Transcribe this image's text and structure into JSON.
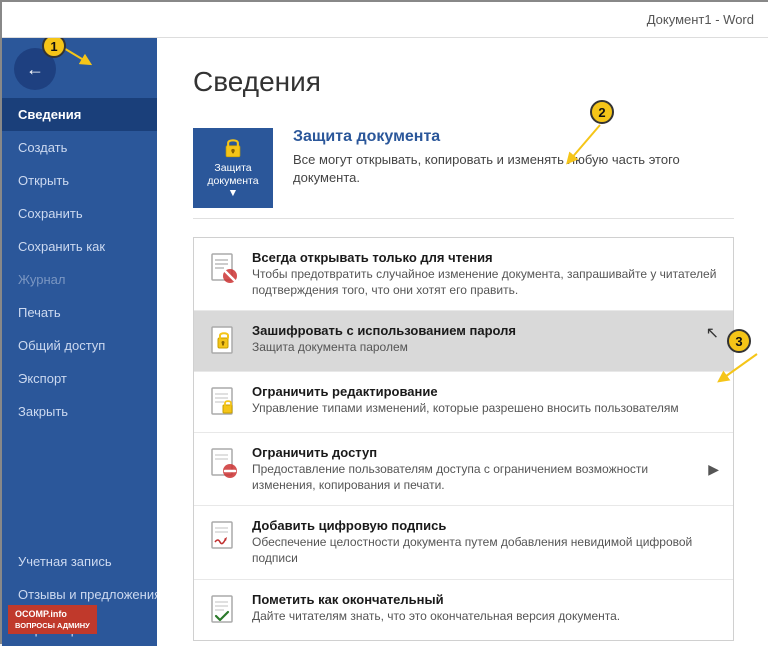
{
  "titlebar": {
    "text": "Документ1 - Word"
  },
  "sidebar": {
    "back_label": "←",
    "items": [
      {
        "id": "svedenia",
        "label": "Сведения",
        "active": true
      },
      {
        "id": "sozdat",
        "label": "Создать",
        "active": false
      },
      {
        "id": "otkryt",
        "label": "Открыть",
        "active": false
      },
      {
        "id": "sohranit",
        "label": "Сохранить",
        "active": false
      },
      {
        "id": "sohranit-kak",
        "label": "Сохранить как",
        "active": false
      },
      {
        "id": "zhurnal",
        "label": "Журнал",
        "disabled": true
      },
      {
        "id": "pechat",
        "label": "Печать",
        "active": false
      },
      {
        "id": "obshiy-dostup",
        "label": "Общий доступ",
        "active": false
      },
      {
        "id": "eksport",
        "label": "Экспорт",
        "active": false
      },
      {
        "id": "zakryt",
        "label": "Закрыть",
        "active": false
      }
    ],
    "bottom_items": [
      {
        "id": "uchet-zapis",
        "label": "Учетная запись"
      },
      {
        "id": "otzyvy",
        "label": "Отзывы и предложения"
      },
      {
        "id": "parametry",
        "label": "Параметры"
      }
    ]
  },
  "main": {
    "title": "Сведения",
    "protect": {
      "icon_label": "Защита документа▼",
      "title": "Защита документа",
      "description": "Все могут открывать, копировать и изменять любую часть этого документа."
    },
    "menu_items": [
      {
        "id": "read-only",
        "title": "Всегда открывать только для чтения",
        "description": "Чтобы предотвратить случайное изменение документа, запрашивайте у читателей подтверждения того, что они хотят его править.",
        "icon": "🚫",
        "selected": false,
        "has_arrow": false
      },
      {
        "id": "encrypt",
        "title": "Зашифровать с использованием пароля",
        "description": "Защита документа паролем",
        "icon": "🔐",
        "selected": true,
        "has_arrow": false
      },
      {
        "id": "restrict-edit",
        "title": "Ограничить редактирование",
        "description": "Управление типами изменений, которые разрешено вносить пользователям",
        "icon": "📄",
        "selected": false,
        "has_arrow": false
      },
      {
        "id": "restrict-access",
        "title": "Ограничить доступ",
        "description": "Предоставление пользователям доступа с ограничением возможности изменения, копирования и печати.",
        "icon": "🚫",
        "selected": false,
        "has_arrow": true
      },
      {
        "id": "digital-signature",
        "title": "Добавить цифровую подпись",
        "description": "Обеспечение целостности документа путем добавления невидимой цифровой подписи",
        "icon": "✍️",
        "selected": false,
        "has_arrow": false
      },
      {
        "id": "mark-final",
        "title": "Пометить как окончательный",
        "description": "Дайте читателям знать, что это окончательная версия документа.",
        "icon": "📋",
        "selected": false,
        "has_arrow": false
      }
    ]
  },
  "annotations": [
    {
      "num": "1",
      "desc": "back button annotation"
    },
    {
      "num": "2",
      "desc": "protect document title annotation"
    },
    {
      "num": "3",
      "desc": "encrypt password annotation"
    }
  ],
  "watermark": {
    "line1": "OCOMP.info",
    "line2": "ВОПРОСЫ АДМИНУ"
  }
}
